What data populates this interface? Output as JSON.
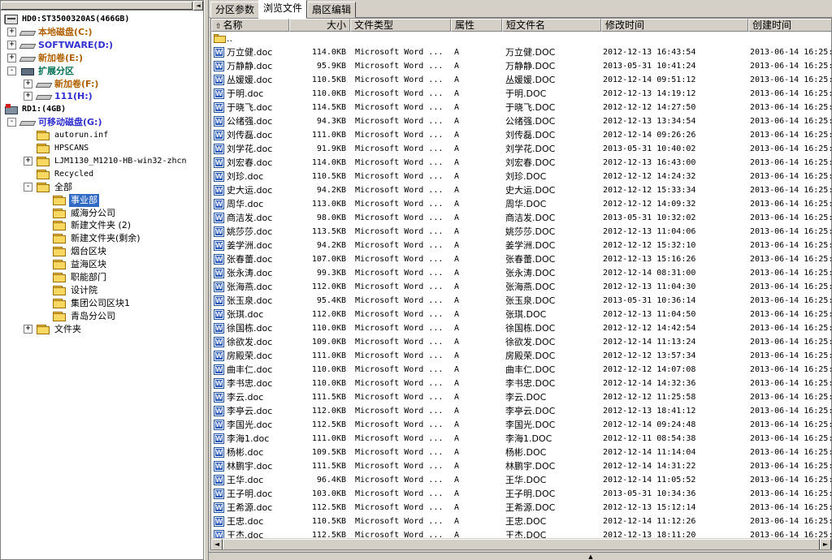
{
  "tree": [
    {
      "level": 0,
      "expander": "-",
      "icon": "hdd",
      "label": "HD0:ST3500320AS(466GB)",
      "style": "bold mono"
    },
    {
      "level": 1,
      "expander": "+",
      "icon": "drive",
      "label": "本地磁盘(C:)",
      "style": "bold c-orange"
    },
    {
      "level": 1,
      "expander": "+",
      "icon": "drive",
      "label": "SOFTWARE(D:)",
      "style": "bold c-blue"
    },
    {
      "level": 1,
      "expander": "+",
      "icon": "drive",
      "label": "新加卷(E:)",
      "style": "bold c-orange"
    },
    {
      "level": 1,
      "expander": "-",
      "icon": "ext",
      "label": "扩展分区",
      "style": "bold c-green"
    },
    {
      "level": 2,
      "expander": "+",
      "icon": "drive",
      "label": "新加卷(F:)",
      "style": "bold c-orange"
    },
    {
      "level": 2,
      "expander": "+",
      "icon": "drive",
      "label": "111(H:)",
      "style": "bold c-blue"
    },
    {
      "level": 0,
      "expander": "",
      "icon": "rd",
      "label": "RD1:(4GB)",
      "style": "bold mono"
    },
    {
      "level": 1,
      "expander": "-",
      "icon": "drive",
      "label": "可移动磁盘(G:)",
      "style": "bold c-blue"
    },
    {
      "level": 2,
      "expander": "",
      "icon": "folder",
      "label": "autorun.inf",
      "style": "mono"
    },
    {
      "level": 2,
      "expander": "",
      "icon": "folder",
      "label": "HPSCANS",
      "style": "mono"
    },
    {
      "level": 2,
      "expander": "+",
      "icon": "folder",
      "label": "LJM1130_M1210-HB-win32-zhcn",
      "style": "mono"
    },
    {
      "level": 2,
      "expander": "",
      "icon": "folder",
      "label": "Recycled",
      "style": "mono"
    },
    {
      "level": 2,
      "expander": "-",
      "icon": "folder",
      "label": "全部",
      "style": ""
    },
    {
      "level": 3,
      "expander": "",
      "icon": "folder",
      "label": "事业部",
      "style": "sel"
    },
    {
      "level": 3,
      "expander": "",
      "icon": "folder",
      "label": "威海分公司",
      "style": ""
    },
    {
      "level": 3,
      "expander": "",
      "icon": "folder",
      "label": "新建文件夹 (2)",
      "style": ""
    },
    {
      "level": 3,
      "expander": "",
      "icon": "folder",
      "label": "新建文件夹(剩余)",
      "style": ""
    },
    {
      "level": 3,
      "expander": "",
      "icon": "folder",
      "label": "烟台区块",
      "style": ""
    },
    {
      "level": 3,
      "expander": "",
      "icon": "folder",
      "label": "益海区块",
      "style": ""
    },
    {
      "level": 3,
      "expander": "",
      "icon": "folder",
      "label": "职能部门",
      "style": ""
    },
    {
      "level": 3,
      "expander": "",
      "icon": "folder",
      "label": "设计院",
      "style": ""
    },
    {
      "level": 3,
      "expander": "",
      "icon": "folder",
      "label": "集团公司区块1",
      "style": ""
    },
    {
      "level": 3,
      "expander": "",
      "icon": "folder",
      "label": "青岛分公司",
      "style": ""
    },
    {
      "level": 2,
      "expander": "+",
      "icon": "folder",
      "label": "文件夹",
      "style": ""
    }
  ],
  "tabs": [
    {
      "label": "分区参数",
      "active": false
    },
    {
      "label": "浏览文件",
      "active": true
    },
    {
      "label": "扇区编辑",
      "active": false
    }
  ],
  "columns": [
    {
      "label": "名称",
      "sort_icon": "↑"
    },
    {
      "label": "大小"
    },
    {
      "label": "文件类型"
    },
    {
      "label": "属性"
    },
    {
      "label": "短文件名"
    },
    {
      "label": "修改时间"
    },
    {
      "label": "创建时间"
    }
  ],
  "parent_row": "..",
  "files": [
    {
      "name": "万立健.doc",
      "size": "114.0KB",
      "type": "Microsoft Word ...",
      "attr": "A",
      "short": "万立健.DOC",
      "modified": "2012-12-13 16:43:54",
      "created": "2013-06-14 16:25:"
    },
    {
      "name": "万静静.doc",
      "size": "95.9KB",
      "type": "Microsoft Word ...",
      "attr": "A",
      "short": "万静静.DOC",
      "modified": "2013-05-31 10:41:24",
      "created": "2013-06-14 16:25:"
    },
    {
      "name": "丛媛媛.doc",
      "size": "110.5KB",
      "type": "Microsoft Word ...",
      "attr": "A",
      "short": "丛媛媛.DOC",
      "modified": "2012-12-14 09:51:12",
      "created": "2013-06-14 16:25:"
    },
    {
      "name": "于明.doc",
      "size": "110.0KB",
      "type": "Microsoft Word ...",
      "attr": "A",
      "short": "于明.DOC",
      "modified": "2012-12-13 14:19:12",
      "created": "2013-06-14 16:25:"
    },
    {
      "name": "于晓飞.doc",
      "size": "114.5KB",
      "type": "Microsoft Word ...",
      "attr": "A",
      "short": "于晓飞.DOC",
      "modified": "2012-12-12 14:27:50",
      "created": "2013-06-14 16:25:"
    },
    {
      "name": "公绪强.doc",
      "size": "94.3KB",
      "type": "Microsoft Word ...",
      "attr": "A",
      "short": "公绪强.DOC",
      "modified": "2012-12-13 13:34:54",
      "created": "2013-06-14 16:25:"
    },
    {
      "name": "刘传磊.doc",
      "size": "111.0KB",
      "type": "Microsoft Word ...",
      "attr": "A",
      "short": "刘传磊.DOC",
      "modified": "2012-12-14 09:26:26",
      "created": "2013-06-14 16:25:"
    },
    {
      "name": "刘学花.doc",
      "size": "91.9KB",
      "type": "Microsoft Word ...",
      "attr": "A",
      "short": "刘学花.DOC",
      "modified": "2013-05-31 10:40:02",
      "created": "2013-06-14 16:25:"
    },
    {
      "name": "刘宏春.doc",
      "size": "114.0KB",
      "type": "Microsoft Word ...",
      "attr": "A",
      "short": "刘宏春.DOC",
      "modified": "2012-12-13 16:43:00",
      "created": "2013-06-14 16:25:"
    },
    {
      "name": "刘珍.doc",
      "size": "110.5KB",
      "type": "Microsoft Word ...",
      "attr": "A",
      "short": "刘珍.DOC",
      "modified": "2012-12-12 14:24:32",
      "created": "2013-06-14 16:25:"
    },
    {
      "name": "史大运.doc",
      "size": "94.2KB",
      "type": "Microsoft Word ...",
      "attr": "A",
      "short": "史大运.DOC",
      "modified": "2012-12-12 15:33:34",
      "created": "2013-06-14 16:25:"
    },
    {
      "name": "周华.doc",
      "size": "113.0KB",
      "type": "Microsoft Word ...",
      "attr": "A",
      "short": "周华.DOC",
      "modified": "2012-12-12 14:09:32",
      "created": "2013-06-14 16:25:"
    },
    {
      "name": "商洁发.doc",
      "size": "98.0KB",
      "type": "Microsoft Word ...",
      "attr": "A",
      "short": "商洁发.DOC",
      "modified": "2013-05-31 10:32:02",
      "created": "2013-06-14 16:25:"
    },
    {
      "name": "姚莎莎.doc",
      "size": "113.5KB",
      "type": "Microsoft Word ...",
      "attr": "A",
      "short": "姚莎莎.DOC",
      "modified": "2012-12-13 11:04:06",
      "created": "2013-06-14 16:25:"
    },
    {
      "name": "姜学洲.doc",
      "size": "94.2KB",
      "type": "Microsoft Word ...",
      "attr": "A",
      "short": "姜学洲.DOC",
      "modified": "2012-12-12 15:32:10",
      "created": "2013-06-14 16:25:"
    },
    {
      "name": "张春蕾.doc",
      "size": "107.0KB",
      "type": "Microsoft Word ...",
      "attr": "A",
      "short": "张春蕾.DOC",
      "modified": "2012-12-13 15:16:26",
      "created": "2013-06-14 16:25:"
    },
    {
      "name": "张永涛.doc",
      "size": "99.3KB",
      "type": "Microsoft Word ...",
      "attr": "A",
      "short": "张永涛.DOC",
      "modified": "2012-12-14 08:31:00",
      "created": "2013-06-14 16:25:"
    },
    {
      "name": "张海燕.doc",
      "size": "112.0KB",
      "type": "Microsoft Word ...",
      "attr": "A",
      "short": "张海燕.DOC",
      "modified": "2012-12-13 11:04:30",
      "created": "2013-06-14 16:25:"
    },
    {
      "name": "张玉泉.doc",
      "size": "95.4KB",
      "type": "Microsoft Word ...",
      "attr": "A",
      "short": "张玉泉.DOC",
      "modified": "2013-05-31 10:36:14",
      "created": "2013-06-14 16:25:"
    },
    {
      "name": "张琪.doc",
      "size": "112.0KB",
      "type": "Microsoft Word ...",
      "attr": "A",
      "short": "张琪.DOC",
      "modified": "2012-12-13 11:04:50",
      "created": "2013-06-14 16:25:"
    },
    {
      "name": "徐国栋.doc",
      "size": "110.0KB",
      "type": "Microsoft Word ...",
      "attr": "A",
      "short": "徐国栋.DOC",
      "modified": "2012-12-12 14:42:54",
      "created": "2013-06-14 16:25:"
    },
    {
      "name": "徐欲发.doc",
      "size": "109.0KB",
      "type": "Microsoft Word ...",
      "attr": "A",
      "short": "徐欲发.DOC",
      "modified": "2012-12-14 11:13:24",
      "created": "2013-06-14 16:25:"
    },
    {
      "name": "房殿荣.doc",
      "size": "111.0KB",
      "type": "Microsoft Word ...",
      "attr": "A",
      "short": "房殿荣.DOC",
      "modified": "2012-12-12 13:57:34",
      "created": "2013-06-14 16:25:"
    },
    {
      "name": "曲丰仁.doc",
      "size": "110.0KB",
      "type": "Microsoft Word ...",
      "attr": "A",
      "short": "曲丰仁.DOC",
      "modified": "2012-12-12 14:07:08",
      "created": "2013-06-14 16:25:"
    },
    {
      "name": "李书忠.doc",
      "size": "110.0KB",
      "type": "Microsoft Word ...",
      "attr": "A",
      "short": "李书忠.DOC",
      "modified": "2012-12-14 14:32:36",
      "created": "2013-06-14 16:25:"
    },
    {
      "name": "李云.doc",
      "size": "111.5KB",
      "type": "Microsoft Word ...",
      "attr": "A",
      "short": "李云.DOC",
      "modified": "2012-12-12 11:25:58",
      "created": "2013-06-14 16:25:"
    },
    {
      "name": "李亭云.doc",
      "size": "112.0KB",
      "type": "Microsoft Word ...",
      "attr": "A",
      "short": "李亭云.DOC",
      "modified": "2012-12-13 18:41:12",
      "created": "2013-06-14 16:25:"
    },
    {
      "name": "李国光.doc",
      "size": "112.5KB",
      "type": "Microsoft Word ...",
      "attr": "A",
      "short": "李国光.DOC",
      "modified": "2012-12-14 09:24:48",
      "created": "2013-06-14 16:25:"
    },
    {
      "name": "李海1.doc",
      "size": "111.0KB",
      "type": "Microsoft Word ...",
      "attr": "A",
      "short": "李海1.DOC",
      "modified": "2012-12-11 08:54:38",
      "created": "2013-06-14 16:25:"
    },
    {
      "name": "杨彬.doc",
      "size": "109.5KB",
      "type": "Microsoft Word ...",
      "attr": "A",
      "short": "杨彬.DOC",
      "modified": "2012-12-14 11:14:04",
      "created": "2013-06-14 16:25:"
    },
    {
      "name": "林鹏宇.doc",
      "size": "111.5KB",
      "type": "Microsoft Word ...",
      "attr": "A",
      "short": "林鹏宇.DOC",
      "modified": "2012-12-14 14:31:22",
      "created": "2013-06-14 16:25:"
    },
    {
      "name": "王华.doc",
      "size": "96.4KB",
      "type": "Microsoft Word ...",
      "attr": "A",
      "short": "王华.DOC",
      "modified": "2012-12-14 11:05:52",
      "created": "2013-06-14 16:25:"
    },
    {
      "name": "王子明.doc",
      "size": "103.0KB",
      "type": "Microsoft Word ...",
      "attr": "A",
      "short": "王子明.DOC",
      "modified": "2013-05-31 10:34:36",
      "created": "2013-06-14 16:25:"
    },
    {
      "name": "王希源.doc",
      "size": "112.5KB",
      "type": "Microsoft Word ...",
      "attr": "A",
      "short": "王希源.DOC",
      "modified": "2012-12-13 15:12:14",
      "created": "2013-06-14 16:25:"
    },
    {
      "name": "王忠.doc",
      "size": "110.5KB",
      "type": "Microsoft Word ...",
      "attr": "A",
      "short": "王忠.DOC",
      "modified": "2012-12-14 11:12:26",
      "created": "2013-06-14 16:25:"
    },
    {
      "name": "王杰.doc",
      "size": "112.5KB",
      "type": "Microsoft Word ...",
      "attr": "A",
      "short": "王杰.DOC",
      "modified": "2012-12-13 18:11:20",
      "created": "2013-06-14 16:25:"
    }
  ],
  "icons": {
    "file": "word-doc-icon",
    "folder": "folder-icon",
    "drive": "drive-icon",
    "hdd": "hard-disk-icon",
    "rd": "removable-disk-icon",
    "ext": "extended-partition-icon"
  },
  "colors": {
    "selection": "#316ac5",
    "drive_orange": "#b06000",
    "drive_blue": "#3030d0",
    "partition_green": "#007050"
  }
}
